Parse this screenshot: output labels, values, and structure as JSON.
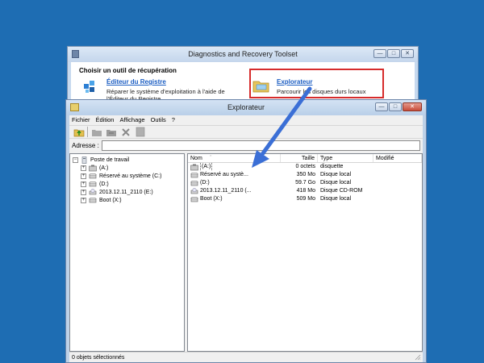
{
  "back_window": {
    "title": "Diagnostics and Recovery Toolset",
    "heading": "Choisir un outil de récupération",
    "buttons": {
      "minimize": "—",
      "maximize": "□",
      "close": "✕"
    },
    "tools": [
      {
        "title": "Éditeur du Registre",
        "description": "Réparer le système d'exploitation à l'aide de l'Éditeur du Registre",
        "icon": "registry-editor-icon"
      },
      {
        "title": "Explorateur",
        "description": "Parcourir les disques durs locaux",
        "icon": "explorer-folder-icon"
      }
    ],
    "highlight_color": "#d62b2b"
  },
  "explorer": {
    "title": "Explorateur",
    "buttons": {
      "minimize": "—",
      "maximize": "□",
      "close": "✕"
    },
    "menu": [
      "Fichier",
      "Édition",
      "Affichage",
      "Outils",
      "?"
    ],
    "toolbar_icons": [
      "up-folder-icon",
      "copy-icon",
      "move-icon",
      "delete-icon",
      "properties-icon"
    ],
    "address_label": "Adresse :",
    "address_value": "",
    "tree": {
      "root": "Poste de travail",
      "items": [
        {
          "label": "(A:)",
          "icon": "floppy-icon"
        },
        {
          "label": "Réservé au système (C:)",
          "icon": "drive-icon"
        },
        {
          "label": "(D:)",
          "icon": "drive-icon"
        },
        {
          "label": "2013.12.11_2110 (E:)",
          "icon": "cdrom-icon"
        },
        {
          "label": "Boot (X:)",
          "icon": "drive-icon"
        }
      ]
    },
    "columns": {
      "name": "Nom",
      "size": "Taille",
      "type": "Type",
      "modified": "Modifié"
    },
    "rows": [
      {
        "name": "(A:)",
        "size": "0 octets",
        "type": "disquette",
        "icon": "floppy-icon"
      },
      {
        "name": "Réservé au systè...",
        "size": "350 Mo",
        "type": "Disque local",
        "icon": "drive-icon"
      },
      {
        "name": "(D:)",
        "size": "59.7 Go",
        "type": "Disque local",
        "icon": "drive-icon"
      },
      {
        "name": "2013.12.11_2110 (...",
        "size": "418 Mo",
        "type": "Disque CD-ROM",
        "icon": "cdrom-icon"
      },
      {
        "name": "Boot (X:)",
        "size": "509 Mo",
        "type": "Disque local",
        "icon": "drive-icon"
      }
    ],
    "status": "0 objets sélectionnés"
  },
  "colors": {
    "desktop": "#1e6db3",
    "arrow": "#3b6fd6",
    "link": "#1a5cc2"
  }
}
